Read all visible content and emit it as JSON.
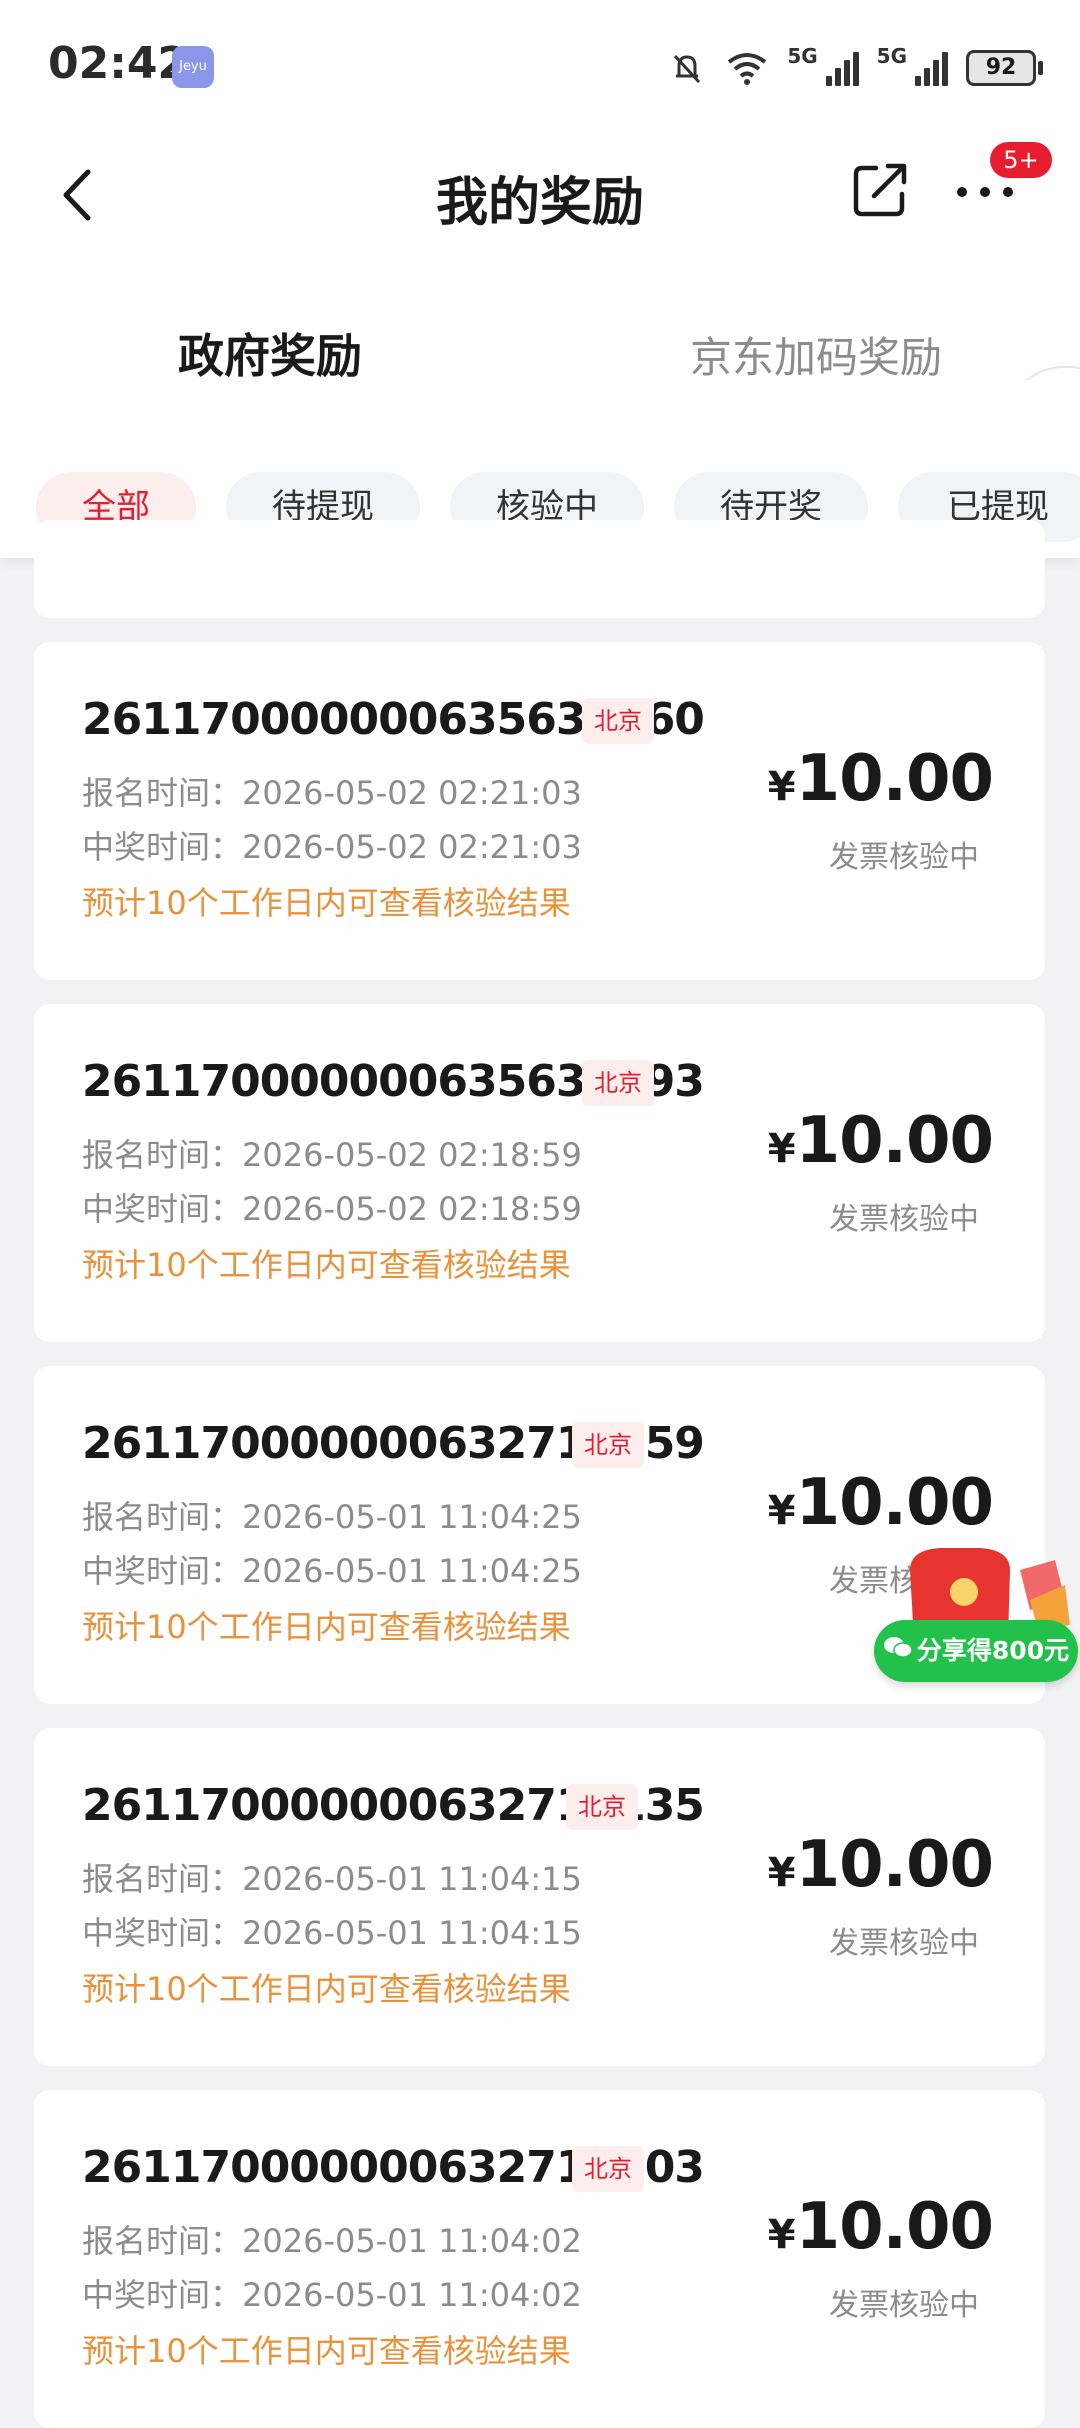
{
  "status_bar": {
    "time": "02:42",
    "app_icon_label": "Jeyu",
    "network_1": "5G",
    "network_2": "5G",
    "battery": "92"
  },
  "header": {
    "title": "我的奖励",
    "more_badge": "5+"
  },
  "main_tabs": [
    {
      "label": "政府奖励",
      "active": true
    },
    {
      "label": "京东加码奖励",
      "active": false
    }
  ],
  "filters": [
    {
      "label": "全部",
      "active": true
    },
    {
      "label": "待提现",
      "active": false
    },
    {
      "label": "核验中",
      "active": false
    },
    {
      "label": "待开奖",
      "active": false
    },
    {
      "label": "已提现",
      "active": false
    }
  ],
  "labels": {
    "signup_prefix": "报名时间：",
    "win_prefix": "中奖时间：",
    "note": "预计10个工作日内可查看核验结果",
    "currency": "¥"
  },
  "rewards": [
    {
      "order_no": "261170000000635634060",
      "city": "北京",
      "signup_time": "2026-05-02 02:21:03",
      "win_time": "2026-05-02 02:21:03",
      "amount": "10.00",
      "status": "发票核验中"
    },
    {
      "order_no": "261170000000635633493",
      "city": "北京",
      "signup_time": "2026-05-02 02:18:59",
      "win_time": "2026-05-02 02:18:59",
      "amount": "10.00",
      "status": "发票核验中"
    },
    {
      "order_no": "261170000000632715759",
      "city": "北京",
      "signup_time": "2026-05-01 11:04:25",
      "win_time": "2026-05-01 11:04:25",
      "amount": "10.00",
      "status": "发票核验中"
    },
    {
      "order_no": "261170000000632717135",
      "city": "北京",
      "signup_time": "2026-05-01 11:04:15",
      "win_time": "2026-05-01 11:04:15",
      "amount": "10.00",
      "status": "发票核验中"
    },
    {
      "order_no": "261170000000632716403",
      "city": "北京",
      "signup_time": "2026-05-01 11:04:02",
      "win_time": "2026-05-01 11:04:02",
      "amount": "10.00",
      "status": "发票核验中"
    }
  ],
  "floating": {
    "share_label": "分享得800元"
  },
  "colors": {
    "accent": "#e81c2f",
    "note": "#e8923c",
    "share_green": "#22c24a"
  }
}
